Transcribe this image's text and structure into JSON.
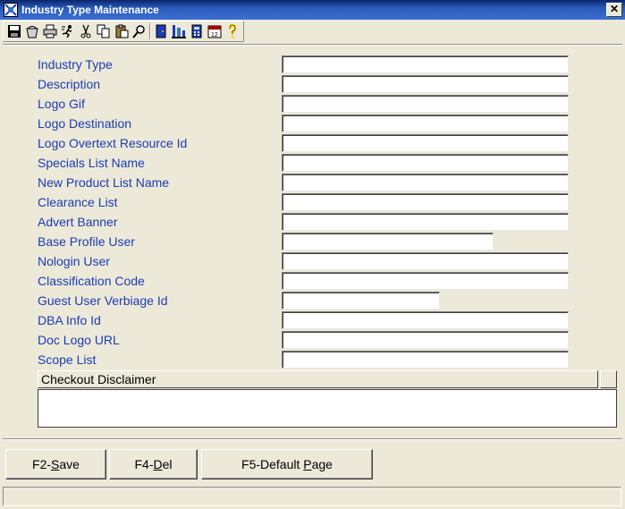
{
  "window": {
    "title": "Industry Type Maintenance",
    "close_label": "✕"
  },
  "toolbar": {
    "buttons": [
      {
        "icon": "save-icon"
      },
      {
        "icon": "bucket-icon"
      },
      {
        "icon": "print-icon"
      },
      {
        "icon": "run-icon"
      },
      {
        "icon": "cut-icon"
      },
      {
        "icon": "copy-icon"
      },
      {
        "icon": "paste-icon"
      },
      {
        "icon": "find-icon"
      },
      {
        "icon": "door-exit-icon"
      },
      {
        "icon": "structure-icon"
      },
      {
        "icon": "calculator-icon"
      },
      {
        "icon": "calendar-icon"
      },
      {
        "icon": "help-icon"
      }
    ]
  },
  "form": {
    "fields": [
      {
        "label": "Industry Type",
        "value": ""
      },
      {
        "label": "Description",
        "value": ""
      },
      {
        "label": "Logo Gif",
        "value": ""
      },
      {
        "label": "Logo Destination",
        "value": ""
      },
      {
        "label": "Logo Overtext Resource Id",
        "value": ""
      },
      {
        "label": "Specials List Name",
        "value": ""
      },
      {
        "label": "New Product List Name",
        "value": ""
      },
      {
        "label": "Clearance List",
        "value": ""
      },
      {
        "label": "Advert Banner",
        "value": ""
      },
      {
        "label": "Base Profile User",
        "value": ""
      },
      {
        "label": "Nologin User",
        "value": ""
      },
      {
        "label": "Classification Code",
        "value": ""
      },
      {
        "label": "Guest User Verbiage Id",
        "value": ""
      },
      {
        "label": "DBA Info Id",
        "value": ""
      },
      {
        "label": "Doc Logo URL",
        "value": ""
      },
      {
        "label": "Scope List",
        "value": ""
      }
    ],
    "grid": {
      "header": "Checkout Disclaimer"
    }
  },
  "footer": {
    "save_prefix": "F2-",
    "save_key": "S",
    "save_rest": "ave",
    "del_prefix": "F4-",
    "del_key": "D",
    "del_rest": "el",
    "default_prefix": "F5-Default ",
    "default_key": "P",
    "default_rest": "age"
  }
}
